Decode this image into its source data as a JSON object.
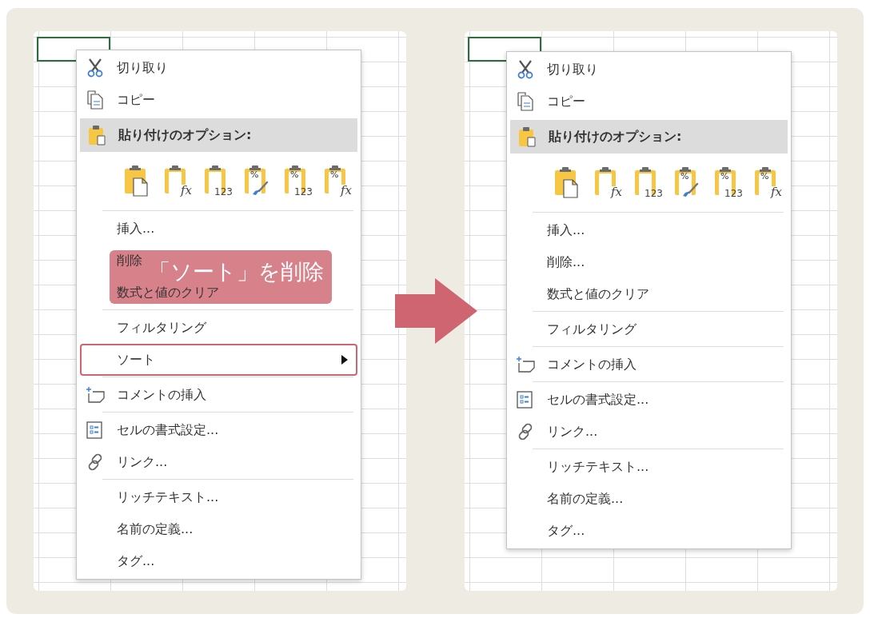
{
  "panels": [
    {
      "menu": {
        "items": [
          {
            "kind": "cut",
            "label": "切り取り"
          },
          {
            "kind": "copy",
            "label": "コピー"
          },
          {
            "kind": "header",
            "label": "貼り付けのオプション:"
          },
          {
            "kind": "paste_row",
            "options": [
              {
                "kind": "document"
              },
              {
                "kind": "formula",
                "caption": "fx"
              },
              {
                "kind": "values",
                "caption": "123"
              },
              {
                "kind": "brush",
                "mark": "%"
              },
              {
                "kind": "values",
                "mark": "%",
                "caption": "123"
              },
              {
                "kind": "formula",
                "mark": "%",
                "caption": "fx"
              }
            ]
          },
          {
            "kind": "separator"
          },
          {
            "kind": "item",
            "label": "挿入..."
          },
          {
            "kind": "item",
            "label": "削除"
          },
          {
            "kind": "item",
            "label": "数式と値のクリア"
          },
          {
            "kind": "separator"
          },
          {
            "kind": "item",
            "label": "フィルタリング"
          },
          {
            "kind": "item",
            "label": "ソート",
            "submenu": true,
            "highlighted": true
          },
          {
            "kind": "separator"
          },
          {
            "kind": "comment",
            "label": "コメントの挿入"
          },
          {
            "kind": "separator"
          },
          {
            "kind": "format",
            "label": "セルの書式設定..."
          },
          {
            "kind": "link",
            "label": "リンク..."
          },
          {
            "kind": "separator"
          },
          {
            "kind": "item",
            "label": "リッチテキスト..."
          },
          {
            "kind": "item",
            "label": "名前の定義..."
          },
          {
            "kind": "item",
            "label": "タグ..."
          }
        ]
      },
      "callout": {
        "text": "「ソート」を削除"
      }
    },
    {
      "menu": {
        "items": [
          {
            "kind": "cut",
            "label": "切り取り"
          },
          {
            "kind": "copy",
            "label": "コピー"
          },
          {
            "kind": "header",
            "label": "貼り付けのオプション:"
          },
          {
            "kind": "paste_row",
            "options": [
              {
                "kind": "document"
              },
              {
                "kind": "formula",
                "caption": "fx"
              },
              {
                "kind": "values",
                "caption": "123"
              },
              {
                "kind": "brush",
                "mark": "%"
              },
              {
                "kind": "values",
                "mark": "%",
                "caption": "123"
              },
              {
                "kind": "formula",
                "mark": "%",
                "caption": "fx"
              }
            ]
          },
          {
            "kind": "separator"
          },
          {
            "kind": "item",
            "label": "挿入..."
          },
          {
            "kind": "item",
            "label": "削除..."
          },
          {
            "kind": "item",
            "label": "数式と値のクリア"
          },
          {
            "kind": "separator"
          },
          {
            "kind": "item",
            "label": "フィルタリング"
          },
          {
            "kind": "separator"
          },
          {
            "kind": "comment",
            "label": "コメントの挿入"
          },
          {
            "kind": "separator"
          },
          {
            "kind": "format",
            "label": "セルの書式設定..."
          },
          {
            "kind": "link",
            "label": "リンク..."
          },
          {
            "kind": "separator"
          },
          {
            "kind": "item",
            "label": "リッチテキスト..."
          },
          {
            "kind": "item",
            "label": "名前の定義..."
          },
          {
            "kind": "item",
            "label": "タグ..."
          }
        ]
      }
    }
  ]
}
